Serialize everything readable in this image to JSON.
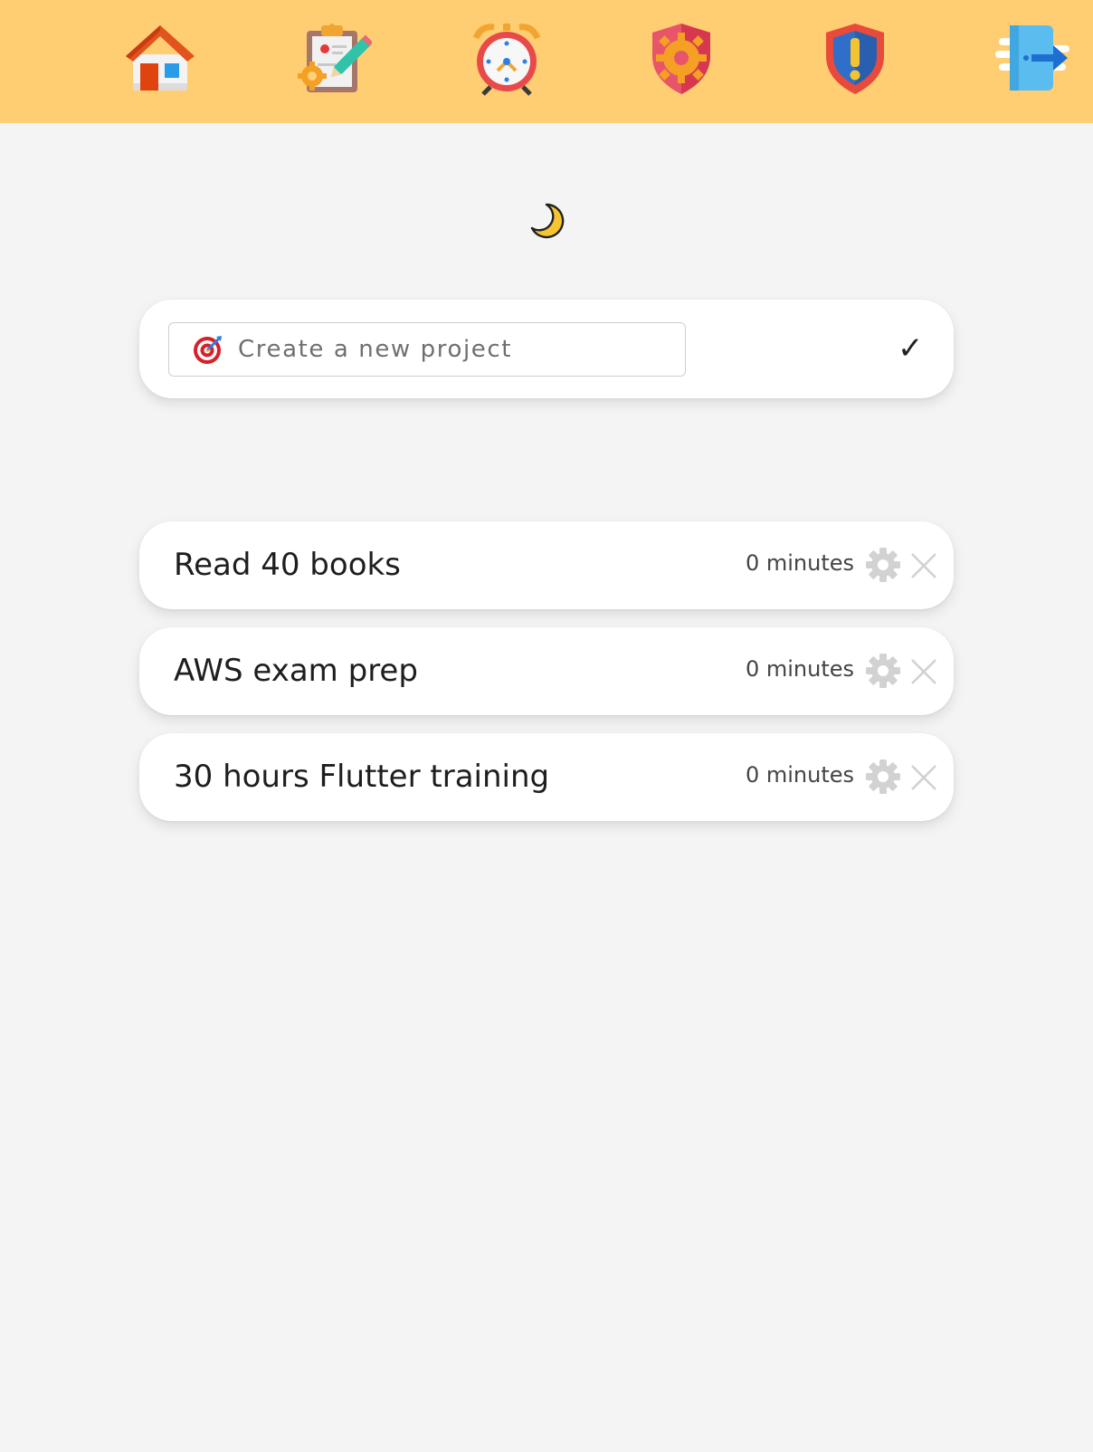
{
  "nav": {
    "background_color": "#ffcd72",
    "items": [
      {
        "name": "home",
        "icon": "house-icon"
      },
      {
        "name": "tasks",
        "icon": "clipboard-pencil-icon"
      },
      {
        "name": "timer",
        "icon": "alarm-clock-icon"
      },
      {
        "name": "settings",
        "icon": "gear-shield-icon"
      },
      {
        "name": "alerts",
        "icon": "warning-shield-icon"
      },
      {
        "name": "logout",
        "icon": "logout-door-icon"
      }
    ]
  },
  "theme_toggle": {
    "icon": "crescent-moon-icon"
  },
  "create_project": {
    "icon": "target-dart-icon",
    "placeholder": "Create a new project",
    "value": "",
    "submit_label": "✓"
  },
  "projects": [
    {
      "name": "Read 40 books",
      "duration": "0 minutes"
    },
    {
      "name": "AWS exam prep",
      "duration": "0 minutes"
    },
    {
      "name": "30 hours Flutter training",
      "duration": "0 minutes"
    }
  ],
  "colors": {
    "page_background": "#f4f4f4",
    "card_background": "#ffffff",
    "action_icon": "#d2d2d2"
  }
}
